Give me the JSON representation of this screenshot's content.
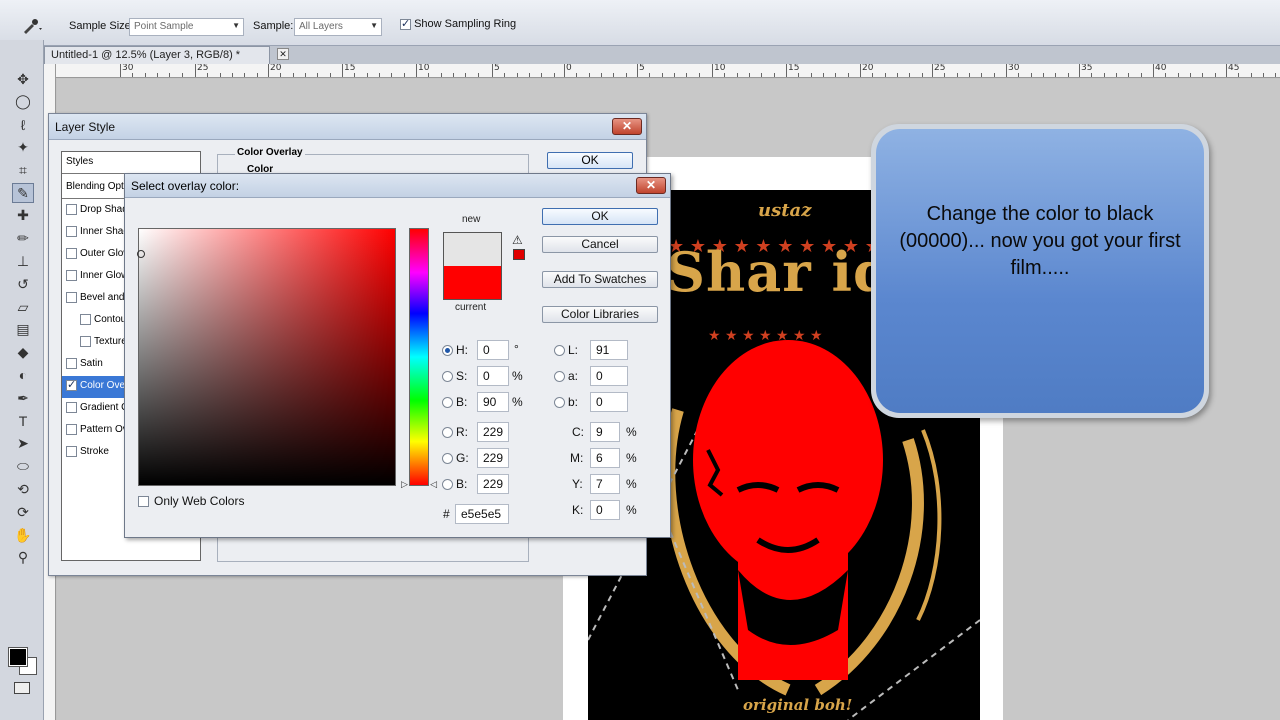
{
  "options_bar": {
    "sample_size_label": "Sample Size:",
    "sample_size_value": "Point Sample",
    "sample_label": "Sample:",
    "sample_value": "All Layers",
    "sampling_ring_label": "Show Sampling Ring",
    "sampling_ring_checked": true
  },
  "doc_tab": {
    "title": "Untitled-1 @ 12.5% (Layer 3, RGB/8) *",
    "close": "✕"
  },
  "ruler": {
    "labels": [
      "30",
      "25",
      "20",
      "15",
      "10",
      "5",
      "0",
      "5",
      "10",
      "15",
      "20",
      "25",
      "30",
      "35",
      "40",
      "45"
    ]
  },
  "tools": [
    "move-icon",
    "marquee-icon",
    "lasso-icon",
    "magic-wand-icon",
    "crop-icon",
    "eyedropper-icon",
    "healing-icon",
    "brush-icon",
    "stamp-icon",
    "history-brush-icon",
    "eraser-icon",
    "gradient-icon",
    "blur-icon",
    "dodge-icon",
    "pen-icon",
    "type-icon",
    "path-select-icon",
    "shape-icon",
    "3d-rotate-icon",
    "3d-orbit-icon",
    "hand-icon",
    "zoom-icon"
  ],
  "layer_style": {
    "title": "Layer Style",
    "close": "✕",
    "ok": "OK",
    "group_title": "Color Overlay",
    "group_sub": "Color",
    "styles_header": "Styles",
    "blending_header": "Blending Options: Default",
    "items": [
      {
        "label": "Drop Shadow",
        "checked": false
      },
      {
        "label": "Inner Shadow",
        "checked": false
      },
      {
        "label": "Outer Glow",
        "checked": false
      },
      {
        "label": "Inner Glow",
        "checked": false
      },
      {
        "label": "Bevel and Emboss",
        "checked": false
      },
      {
        "label": "Contour",
        "checked": false
      },
      {
        "label": "Texture",
        "checked": false
      },
      {
        "label": "Satin",
        "checked": false
      },
      {
        "label": "Color Overlay",
        "checked": true
      },
      {
        "label": "Gradient Overlay",
        "checked": false
      },
      {
        "label": "Pattern Overlay",
        "checked": false
      },
      {
        "label": "Stroke",
        "checked": false
      }
    ]
  },
  "picker": {
    "title": "Select overlay color:",
    "close": "✕",
    "new_label": "new",
    "current_label": "current",
    "new_color": "#e5e5e5",
    "current_color": "#ff0000",
    "buttons": {
      "ok": "OK",
      "cancel": "Cancel",
      "add_swatches": "Add To Swatches",
      "libraries": "Color Libraries"
    },
    "only_web_colors": "Only Web Colors",
    "hsb": {
      "h": "0",
      "s": "0",
      "b": "90",
      "h_unit": "°",
      "s_unit": "%",
      "b_unit": "%"
    },
    "rgb": {
      "r": "229",
      "g": "229",
      "b": "229"
    },
    "lab": {
      "l": "91",
      "a": "0",
      "b": "0"
    },
    "cmyk": {
      "c": "9",
      "m": "6",
      "y": "7",
      "k": "0",
      "unit": "%"
    },
    "hex": "e5e5e5",
    "labels": {
      "h": "H:",
      "s": "S:",
      "bri": "B:",
      "r": "R:",
      "g": "G:",
      "b": "B:",
      "l": "L:",
      "a": "a:",
      "lb": "b:",
      "c": "C:",
      "m": "M:",
      "y": "Y:",
      "k": "K:",
      "hash": "#"
    }
  },
  "poster": {
    "top_word": "ustaz",
    "main_word": "Shar idr",
    "bottom_word": "original boh!"
  },
  "callout": {
    "text": "Change the color to black (00000)... now you got your first film....."
  }
}
